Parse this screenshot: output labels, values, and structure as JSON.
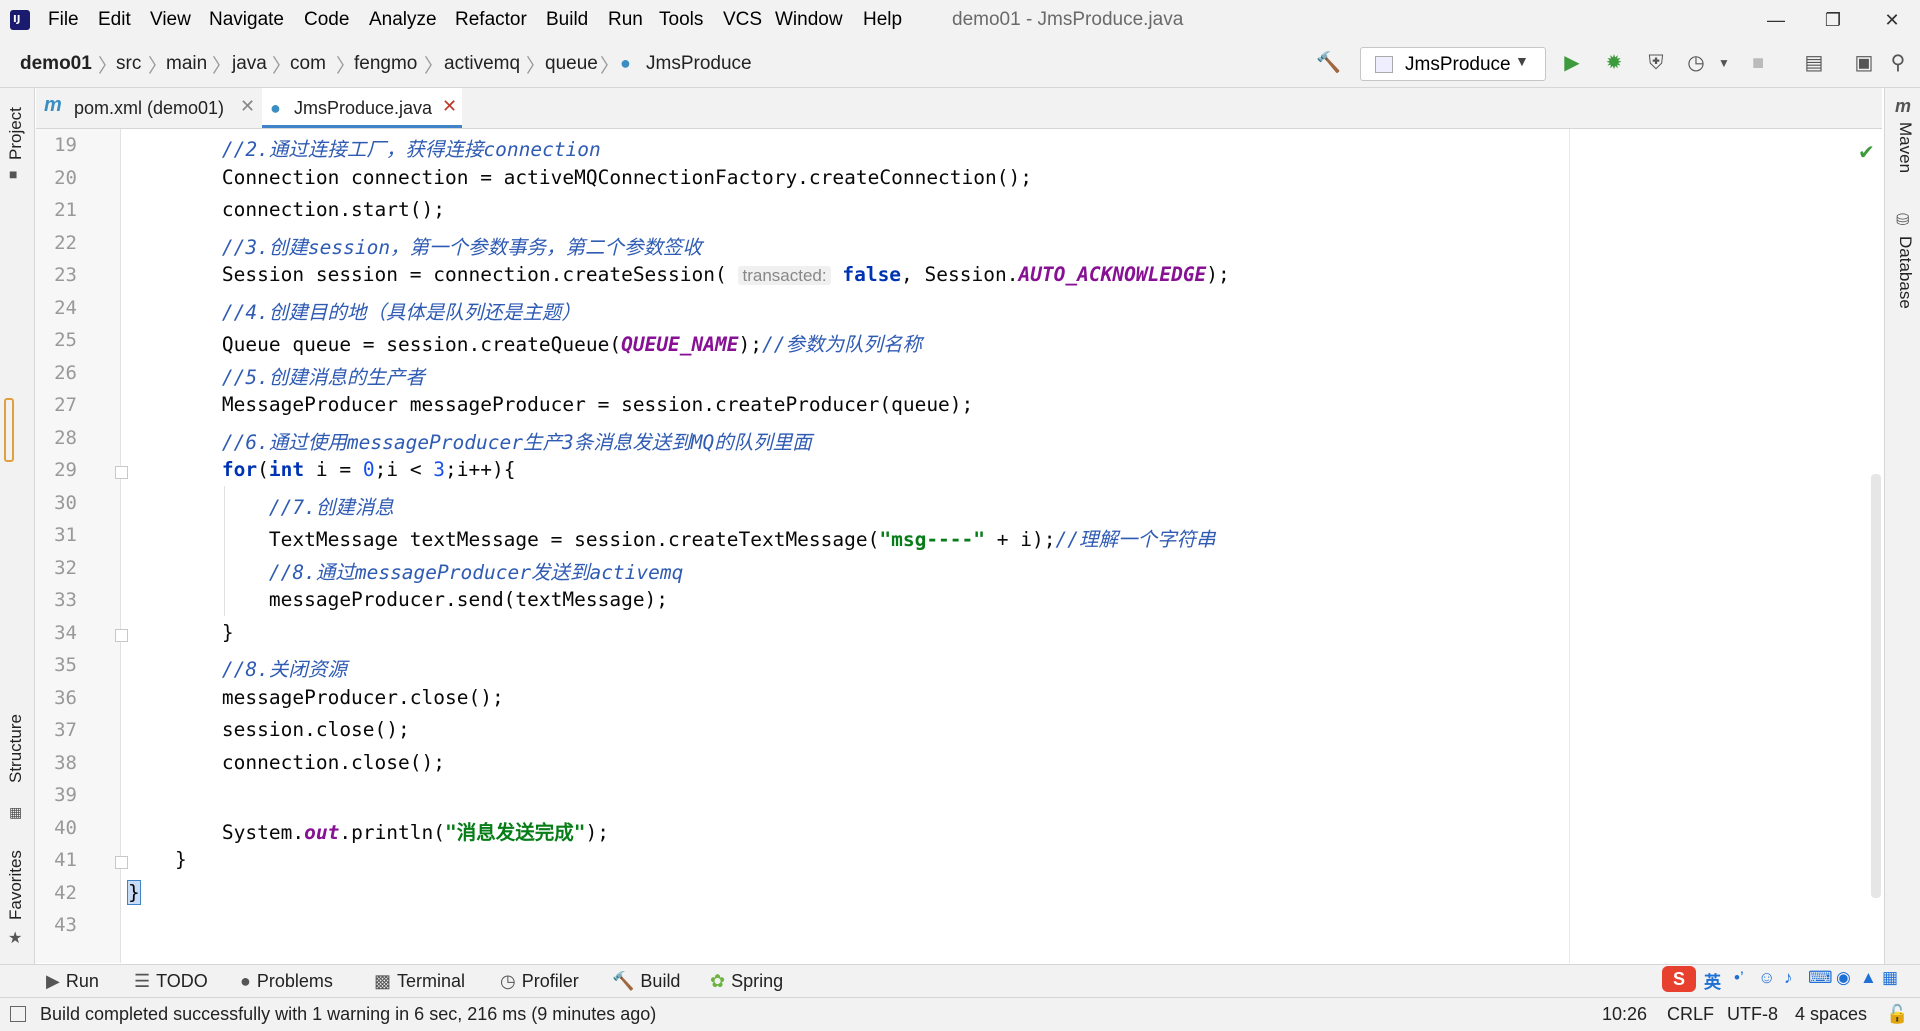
{
  "menu": [
    "File",
    "Edit",
    "View",
    "Navigate",
    "Code",
    "Analyze",
    "Refactor",
    "Build",
    "Run",
    "Tools",
    "VCS",
    "Window",
    "Help"
  ],
  "window_title": "demo01 - JmsProduce.java",
  "breadcrumbs": [
    "demo01",
    "src",
    "main",
    "java",
    "com",
    "fengmo",
    "activemq",
    "queue",
    "JmsProduce"
  ],
  "run_config": "JmsProduce",
  "tabs": [
    {
      "label": "pom.xml (demo01)",
      "icon": "maven-icon"
    },
    {
      "label": "JmsProduce.java",
      "icon": "class-icon"
    }
  ],
  "left_tools": [
    "Project",
    "Structure",
    "Favorites"
  ],
  "right_tools": [
    "Maven",
    "Database"
  ],
  "code": {
    "lines": [
      {
        "n": "19",
        "segs": [
          {
            "t": "        "
          },
          {
            "t": "//2.通过连接工厂，获得连接connection",
            "c": "cmt"
          }
        ]
      },
      {
        "n": "20",
        "segs": [
          {
            "t": "        Connection connection = activeMQConnectionFactory.createConnection();"
          }
        ]
      },
      {
        "n": "21",
        "segs": [
          {
            "t": "        connection.start();"
          }
        ]
      },
      {
        "n": "22",
        "segs": [
          {
            "t": "        "
          },
          {
            "t": "//3.创建session，第一个参数事务，第二个参数签收",
            "c": "cmt"
          }
        ]
      },
      {
        "n": "23",
        "segs": [
          {
            "t": "        Session session = connection.createSession( "
          },
          {
            "t": "transacted:",
            "c": "hint"
          },
          {
            "t": " "
          },
          {
            "t": "false",
            "c": "kw"
          },
          {
            "t": ", Session."
          },
          {
            "t": "AUTO_ACKNOWLEDGE",
            "c": "const"
          },
          {
            "t": ");"
          }
        ]
      },
      {
        "n": "24",
        "segs": [
          {
            "t": "        "
          },
          {
            "t": "//4.创建目的地（具体是队列还是主题）",
            "c": "cmt"
          }
        ]
      },
      {
        "n": "25",
        "segs": [
          {
            "t": "        Queue queue = session.createQueue("
          },
          {
            "t": "QUEUE_NAME",
            "c": "const"
          },
          {
            "t": ");"
          },
          {
            "t": "//参数为队列名称",
            "c": "cmt"
          }
        ]
      },
      {
        "n": "26",
        "segs": [
          {
            "t": "        "
          },
          {
            "t": "//5.创建消息的生产者",
            "c": "cmt"
          }
        ]
      },
      {
        "n": "27",
        "segs": [
          {
            "t": "        MessageProducer messageProducer = session.createProducer(queue);"
          }
        ]
      },
      {
        "n": "28",
        "segs": [
          {
            "t": "        "
          },
          {
            "t": "//6.通过使用messageProducer生产3条消息发送到MQ的队列里面",
            "c": "cmt"
          }
        ]
      },
      {
        "n": "29",
        "segs": [
          {
            "t": "        "
          },
          {
            "t": "for",
            "c": "kw"
          },
          {
            "t": "("
          },
          {
            "t": "int",
            "c": "kw"
          },
          {
            "t": " i = "
          },
          {
            "t": "0",
            "c": "num"
          },
          {
            "t": ";i < "
          },
          {
            "t": "3",
            "c": "num"
          },
          {
            "t": ";i++){"
          }
        ]
      },
      {
        "n": "30",
        "segs": [
          {
            "t": "            "
          },
          {
            "t": "//7.创建消息",
            "c": "cmt"
          }
        ]
      },
      {
        "n": "31",
        "segs": [
          {
            "t": "            TextMessage textMessage = session.createTextMessage("
          },
          {
            "t": "\"msg----\"",
            "c": "str"
          },
          {
            "t": " + i);"
          },
          {
            "t": "//理解一个字符串",
            "c": "cmt"
          }
        ]
      },
      {
        "n": "32",
        "segs": [
          {
            "t": "            "
          },
          {
            "t": "//8.通过messageProducer发送到activemq",
            "c": "cmt"
          }
        ]
      },
      {
        "n": "33",
        "segs": [
          {
            "t": "            messageProducer.send(textMessage);"
          }
        ]
      },
      {
        "n": "34",
        "segs": [
          {
            "t": "        }"
          }
        ]
      },
      {
        "n": "35",
        "segs": [
          {
            "t": "        "
          },
          {
            "t": "//8.关闭资源",
            "c": "cmt"
          }
        ]
      },
      {
        "n": "36",
        "segs": [
          {
            "t": "        messageProducer.close();"
          }
        ]
      },
      {
        "n": "37",
        "segs": [
          {
            "t": "        session.close();"
          }
        ]
      },
      {
        "n": "38",
        "segs": [
          {
            "t": "        connection.close();"
          }
        ]
      },
      {
        "n": "39",
        "segs": [
          {
            "t": ""
          }
        ]
      },
      {
        "n": "40",
        "segs": [
          {
            "t": "        System."
          },
          {
            "t": "out",
            "c": "fld"
          },
          {
            "t": ".println("
          },
          {
            "t": "\"消息发送完成\"",
            "c": "str"
          },
          {
            "t": ");"
          }
        ]
      },
      {
        "n": "41",
        "segs": [
          {
            "t": "    }"
          }
        ]
      },
      {
        "n": "42",
        "segs": [
          {
            "t": "}"
          }
        ]
      },
      {
        "n": "43",
        "segs": [
          {
            "t": ""
          }
        ]
      }
    ]
  },
  "bottom_tools": [
    {
      "label": "Run",
      "icon": "play-icon"
    },
    {
      "label": "TODO",
      "icon": "list-icon"
    },
    {
      "label": "Problems",
      "icon": "problems-icon"
    },
    {
      "label": "Terminal",
      "icon": "terminal-icon"
    },
    {
      "label": "Profiler",
      "icon": "profiler-icon"
    },
    {
      "label": "Build",
      "icon": "hammer-icon"
    },
    {
      "label": "Spring",
      "icon": "spring-icon"
    }
  ],
  "status": {
    "message": "Build completed successfully with 1 warning in 6 sec, 216 ms (9 minutes ago)",
    "position": "10:26",
    "line_ending": "CRLF",
    "encoding": "UTF-8",
    "indent": "4 spaces"
  },
  "ime": {
    "lang": "英"
  },
  "colors": {
    "accent": "#4083c9",
    "run": "#3d9a3d",
    "comment": "#2f5bb3",
    "keyword": "#0033b3",
    "string": "#067d17",
    "constant": "#871094"
  }
}
